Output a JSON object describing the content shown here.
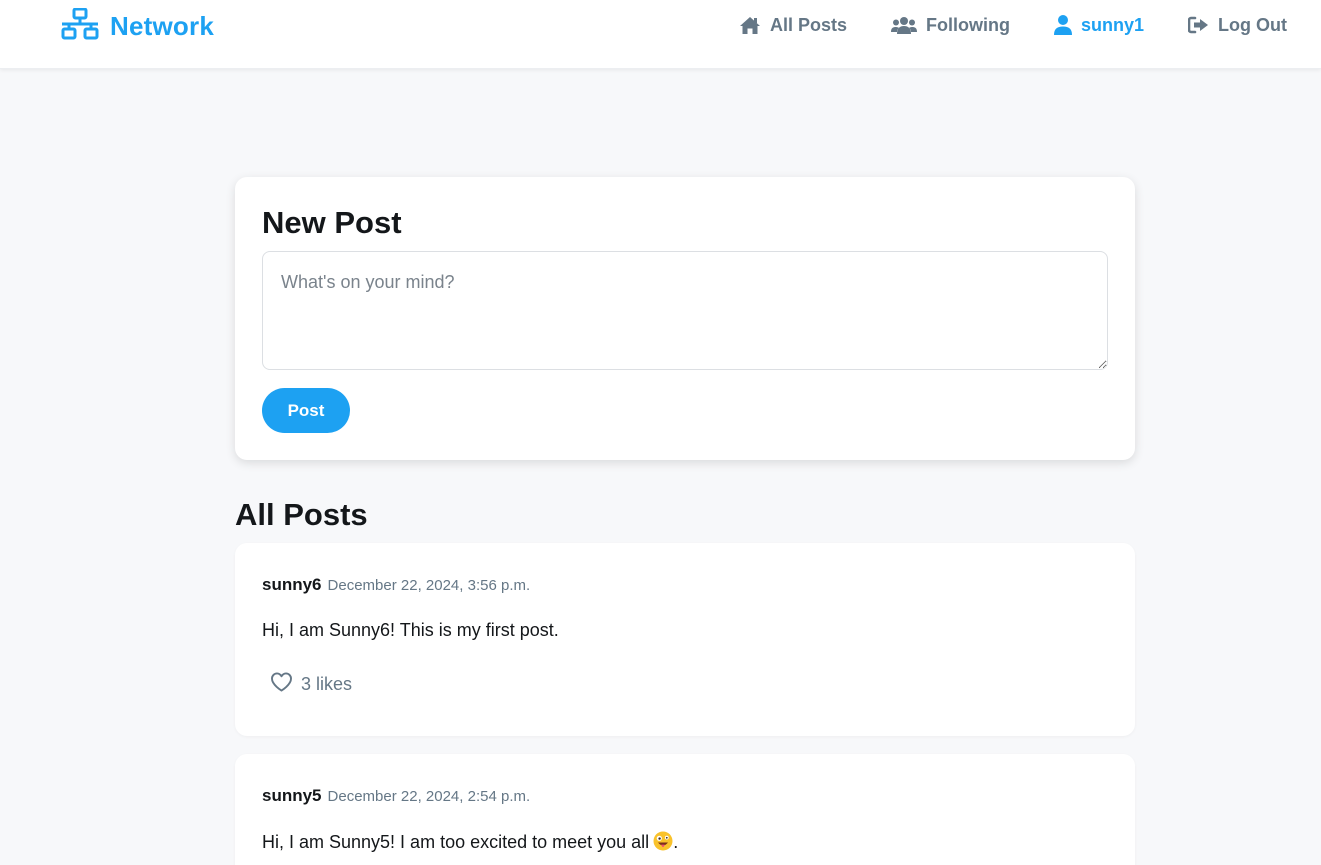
{
  "brand": {
    "name": "Network",
    "icon": "network-icon",
    "color": "#1da1f2"
  },
  "nav": {
    "links": [
      {
        "label": "All Posts",
        "icon": "home-icon"
      },
      {
        "label": "Following",
        "icon": "users-icon"
      },
      {
        "label": "sunny1",
        "icon": "user-icon"
      },
      {
        "label": "Log Out",
        "icon": "logout-icon"
      }
    ]
  },
  "new_post": {
    "title": "New Post",
    "placeholder": "What's on your mind?",
    "value": "",
    "button_label": "Post"
  },
  "feed": {
    "title": "All Posts",
    "posts": [
      {
        "author": "sunny6",
        "timestamp": "December 22, 2024, 3:56 p.m.",
        "content": "Hi, I am Sunny6! This is my first post.",
        "likes_label": "3 likes",
        "liked": false
      },
      {
        "author": "sunny5",
        "timestamp": "December 22, 2024, 2:54 p.m.",
        "content": "Hi, I am Sunny5! I am too excited to meet you all",
        "content_suffix": ".",
        "emoji": "zany-face-emoji"
      }
    ]
  },
  "colors": {
    "accent": "#1da1f2",
    "muted": "#657786",
    "background": "#f7f8fa"
  }
}
